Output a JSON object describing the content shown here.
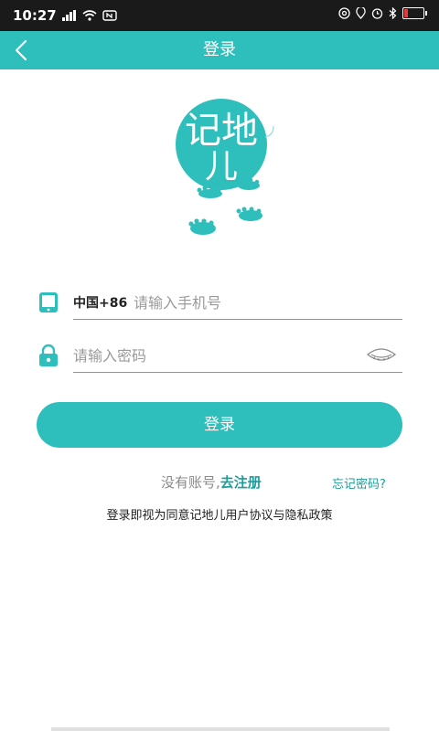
{
  "status_bar": {
    "time": "10:27",
    "icons": [
      "signal-icon",
      "wifi-icon",
      "nfc-icon",
      "at-icon",
      "location-icon",
      "alarm-icon",
      "bluetooth-icon",
      "battery-icon"
    ]
  },
  "header": {
    "title": "登录",
    "background": "#2ebfbc"
  },
  "logo": {
    "text_top": "记地",
    "text_bottom": "儿"
  },
  "form": {
    "country_code": "中国+86",
    "phone_placeholder": "请输入手机号",
    "password_placeholder": "请输入密码"
  },
  "login_button": {
    "label": "登录"
  },
  "links": {
    "no_account": "没有账号,",
    "register": "去注册",
    "forgot_password": "忘记密码?"
  },
  "agreement": "登录即视为同意记地儿用户协议与隐私政策",
  "colors": {
    "accent": "#2ebfbc",
    "link": "#1a9e9b"
  }
}
